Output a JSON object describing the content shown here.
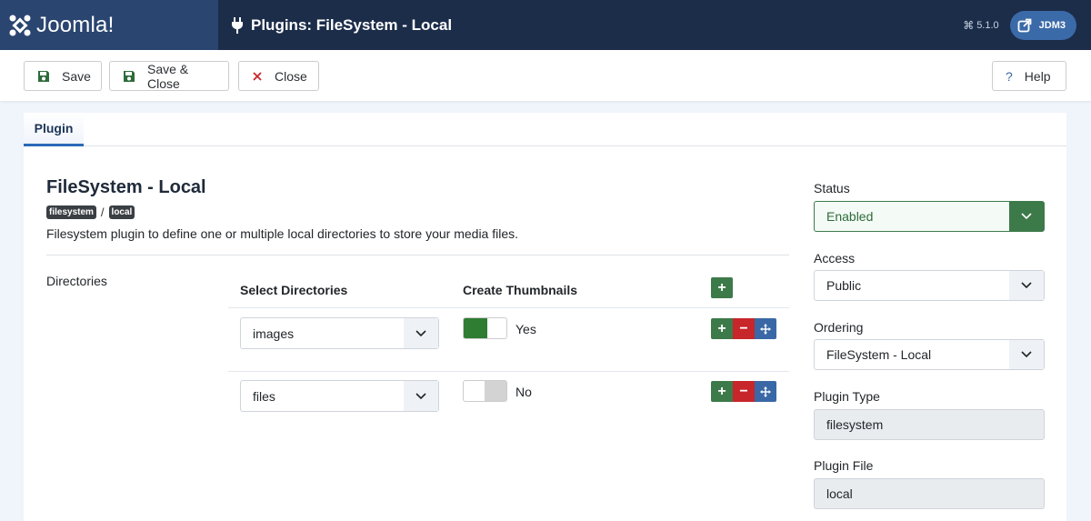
{
  "header": {
    "logo_text": "Joomla!",
    "page_title": "Plugins: FileSystem - Local",
    "version": "5.1.0",
    "site_name": "JDM3"
  },
  "toolbar": {
    "save_label": "Save",
    "save_close_label": "Save & Close",
    "close_label": "Close",
    "help_label": "Help"
  },
  "tabs": [
    {
      "label": "Plugin",
      "active": true
    }
  ],
  "plugin": {
    "title": "FileSystem - Local",
    "badges": [
      "filesystem",
      "local"
    ],
    "separator": "/",
    "description": "Filesystem plugin to define one or multiple local directories to store your media files."
  },
  "directories": {
    "label": "Directories",
    "col_select": "Select Directories",
    "col_thumbs": "Create Thumbnails",
    "rows": [
      {
        "directory": "images",
        "thumbnails": "Yes"
      },
      {
        "directory": "files",
        "thumbnails": "No"
      }
    ]
  },
  "sidebar": {
    "status_label": "Status",
    "status_value": "Enabled",
    "access_label": "Access",
    "access_value": "Public",
    "ordering_label": "Ordering",
    "ordering_value": "FileSystem - Local",
    "type_label": "Plugin Type",
    "type_value": "filesystem",
    "file_label": "Plugin File",
    "file_value": "local"
  },
  "colors": {
    "header_bg": "#1c2d4a",
    "logo_bg": "#2a4570",
    "success": "#3d7a4a",
    "danger": "#c7262a",
    "primary": "#3a68a6"
  }
}
